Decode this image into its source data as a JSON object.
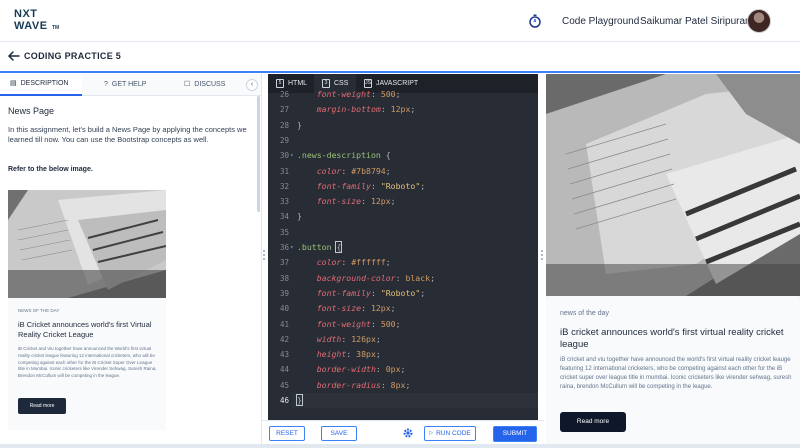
{
  "navbar": {
    "logo_line1": "NXT",
    "logo_line2": "WAVE",
    "logo_tm": "TM",
    "playground_label": "Code Playground",
    "user_name": "Saikumar Patel Siripuram"
  },
  "header": {
    "title": "CODING PRACTICE 5"
  },
  "tabs": {
    "description": "DESCRIPTION",
    "get_help": "GET HELP",
    "discuss": "DISCUSS"
  },
  "description": {
    "title": "News Page",
    "text": "In this assignment, let's build a News Page by applying the concepts we learned till now. You can use the Bootstrap concepts as well.",
    "refer": "Refer to the below image."
  },
  "preview": {
    "tag": "NEWS OF THE DAY",
    "headline": "iB Cricket announces world's first Virtual Reality Cricket League",
    "text": "iB Cricket and Viu together have announced the World's first virtual reality cricket league featuring 12 international cricketers, who will be competing against each other for the iB Cricket Super Over League title in Mumbai. Iconic cricketers like Virender Sehwag, Suresh Raina, Brendon McCullum will be competing in the league.",
    "button": "Read more"
  },
  "editor": {
    "tabs": [
      "HTML",
      "CSS",
      "JAVASCRIPT"
    ],
    "lines": [
      {
        "n": "26",
        "parts": [
          [
            "p",
            "    "
          ],
          [
            "prop",
            "font-weight"
          ],
          [
            "p",
            ": "
          ],
          [
            "val",
            "500"
          ],
          [
            "p",
            ";"
          ]
        ]
      },
      {
        "n": "27",
        "parts": [
          [
            "p",
            "    "
          ],
          [
            "prop",
            "margin-bottom"
          ],
          [
            "p",
            ": "
          ],
          [
            "val",
            "12px"
          ],
          [
            "p",
            ";"
          ]
        ]
      },
      {
        "n": "28",
        "parts": [
          [
            "p",
            "}"
          ]
        ]
      },
      {
        "n": "29",
        "parts": []
      },
      {
        "n": "30",
        "fold": true,
        "parts": [
          [
            "sel",
            ".news-description"
          ],
          [
            "p",
            " {"
          ]
        ]
      },
      {
        "n": "31",
        "parts": [
          [
            "p",
            "    "
          ],
          [
            "prop",
            "color"
          ],
          [
            "p",
            ": "
          ],
          [
            "val",
            "#7b8794"
          ],
          [
            "p",
            ";"
          ]
        ]
      },
      {
        "n": "32",
        "parts": [
          [
            "p",
            "    "
          ],
          [
            "prop",
            "font-family"
          ],
          [
            "p",
            ": "
          ],
          [
            "str",
            "\"Roboto\""
          ],
          [
            "p",
            ";"
          ]
        ]
      },
      {
        "n": "33",
        "parts": [
          [
            "p",
            "    "
          ],
          [
            "prop",
            "font-size"
          ],
          [
            "p",
            ": "
          ],
          [
            "val",
            "12px"
          ],
          [
            "p",
            ";"
          ]
        ]
      },
      {
        "n": "34",
        "parts": [
          [
            "p",
            "}"
          ]
        ]
      },
      {
        "n": "35",
        "parts": []
      },
      {
        "n": "36",
        "fold": true,
        "parts": [
          [
            "sel",
            ".button"
          ],
          [
            "p",
            " "
          ],
          [
            "hi",
            "{"
          ]
        ]
      },
      {
        "n": "37",
        "parts": [
          [
            "p",
            "    "
          ],
          [
            "prop",
            "color"
          ],
          [
            "p",
            ": "
          ],
          [
            "val",
            "#ffffff"
          ],
          [
            "p",
            ";"
          ]
        ]
      },
      {
        "n": "38",
        "parts": [
          [
            "p",
            "    "
          ],
          [
            "prop",
            "background-color"
          ],
          [
            "p",
            ": "
          ],
          [
            "val",
            "black"
          ],
          [
            "p",
            ";"
          ]
        ]
      },
      {
        "n": "39",
        "parts": [
          [
            "p",
            "    "
          ],
          [
            "prop",
            "font-family"
          ],
          [
            "p",
            ": "
          ],
          [
            "str",
            "\"Roboto\""
          ],
          [
            "p",
            ";"
          ]
        ]
      },
      {
        "n": "40",
        "parts": [
          [
            "p",
            "    "
          ],
          [
            "prop",
            "font-size"
          ],
          [
            "p",
            ": "
          ],
          [
            "val",
            "12px"
          ],
          [
            "p",
            ";"
          ]
        ]
      },
      {
        "n": "41",
        "parts": [
          [
            "p",
            "    "
          ],
          [
            "prop",
            "font-weight"
          ],
          [
            "p",
            ": "
          ],
          [
            "val",
            "500"
          ],
          [
            "p",
            ";"
          ]
        ]
      },
      {
        "n": "42",
        "parts": [
          [
            "p",
            "    "
          ],
          [
            "prop",
            "width"
          ],
          [
            "p",
            ": "
          ],
          [
            "val",
            "126px"
          ],
          [
            "p",
            ";"
          ]
        ]
      },
      {
        "n": "43",
        "parts": [
          [
            "p",
            "    "
          ],
          [
            "prop",
            "height"
          ],
          [
            "p",
            ": "
          ],
          [
            "val",
            "38px"
          ],
          [
            "p",
            ";"
          ]
        ]
      },
      {
        "n": "44",
        "parts": [
          [
            "p",
            "    "
          ],
          [
            "prop",
            "border-width"
          ],
          [
            "p",
            ": "
          ],
          [
            "val",
            "0px"
          ],
          [
            "p",
            ";"
          ]
        ]
      },
      {
        "n": "45",
        "parts": [
          [
            "p",
            "    "
          ],
          [
            "prop",
            "border-radius"
          ],
          [
            "p",
            ": "
          ],
          [
            "val",
            "8px"
          ],
          [
            "p",
            ";"
          ]
        ]
      },
      {
        "n": "46",
        "active": true,
        "parts": [
          [
            "hi",
            "}"
          ]
        ]
      }
    ]
  },
  "footer": {
    "reset": "RESET",
    "save": "SAVE",
    "run_code": "RUN CODE",
    "submit": "SUBMIT"
  },
  "output": {
    "tag": "news of the day",
    "headline": "iB cricket announces world's first virtual reality cricket league",
    "text": "iB cricket and viu together have announced the world's first virtual reality cricket leauge featuring 12 international cricketers, who be competing against each other for the iB cricket super over league title in mumbai. Iconic cricketers like virender sehwag, suresh raina, brendon McCullum will be competing in the league.",
    "button": "Read more"
  },
  "colors": {
    "accent": "#2563eb",
    "editor_bg": "#282c34"
  }
}
